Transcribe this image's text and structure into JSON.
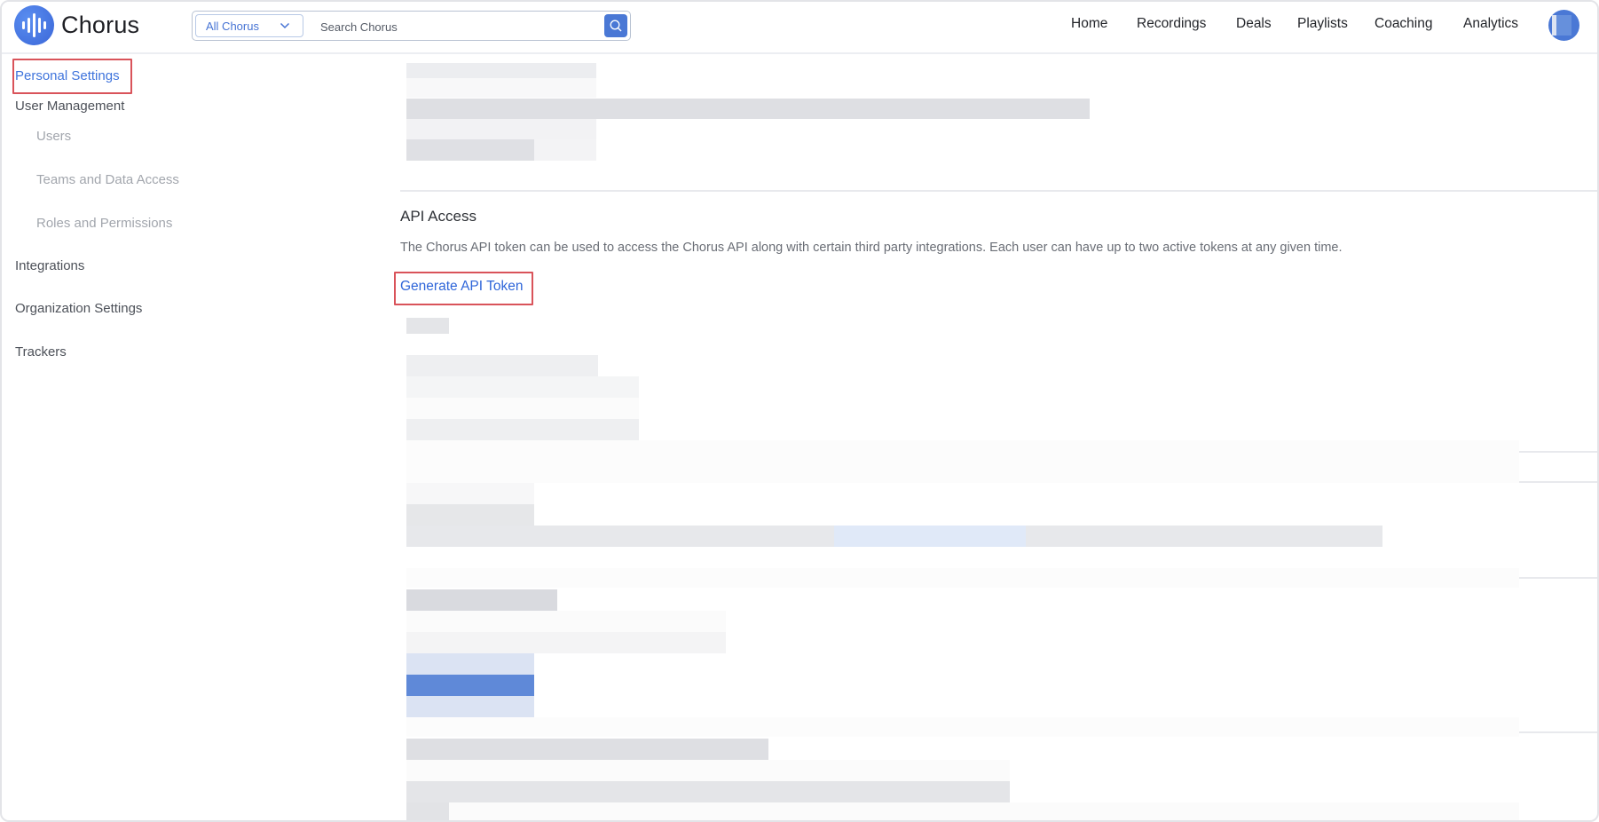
{
  "app": {
    "name": "Chorus",
    "brand_color": "#3f74dc",
    "highlight_color": "#d9535a"
  },
  "header": {
    "logo_text": "Chorus",
    "search": {
      "scope_label": "All Chorus",
      "placeholder": "Search Chorus",
      "value": ""
    },
    "nav": [
      {
        "label": "Home"
      },
      {
        "label": "Recordings"
      },
      {
        "label": "Deals"
      },
      {
        "label": "Playlists"
      },
      {
        "label": "Coaching"
      },
      {
        "label": "Analytics"
      }
    ]
  },
  "sidebar": {
    "items": [
      {
        "label": "Personal Settings",
        "active": true,
        "highlighted": true
      },
      {
        "label": "User Management"
      },
      {
        "label": "Users",
        "sub": true
      },
      {
        "label": "Teams and Data Access",
        "sub": true
      },
      {
        "label": "Roles and Permissions",
        "sub": true
      },
      {
        "label": "Integrations"
      },
      {
        "label": "Organization Settings"
      },
      {
        "label": "Trackers"
      }
    ]
  },
  "main": {
    "api_access": {
      "title": "API Access",
      "description": "The Chorus API token can be used to access the Chorus API along with certain third party integrations. Each user can have up to two active tokens at any given time.",
      "generate_button": "Generate API Token"
    }
  }
}
